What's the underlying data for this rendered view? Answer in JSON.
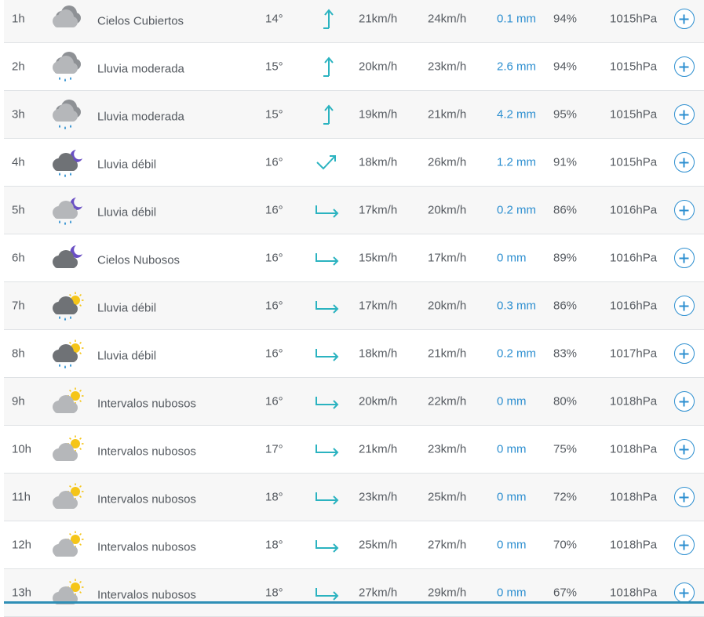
{
  "colors": {
    "rain_text": "#2d8fd0",
    "wind_arrow": "#2bb3c0",
    "plus_button": "#2d8fd0",
    "cloud_light": "#b5b7ba",
    "cloud_dark": "#6f7276",
    "sun": "#f5c518",
    "moon": "#6a4fc4",
    "raindrop": "#2d8fd0"
  },
  "rows": [
    {
      "hour": "1h",
      "icon": "overcast-cloud-icon",
      "description": "Cielos Cubiertos",
      "temperature": "14°",
      "wind_direction": "north-wind-icon",
      "wind": "21km/h",
      "gust": "24km/h",
      "rain": "0.1 mm",
      "humidity": "94%",
      "pressure": "1015hPa"
    },
    {
      "hour": "2h",
      "icon": "rain-cloud-icon",
      "description": "Lluvia moderada",
      "temperature": "15°",
      "wind_direction": "north-wind-icon",
      "wind": "20km/h",
      "gust": "23km/h",
      "rain": "2.6 mm",
      "humidity": "94%",
      "pressure": "1015hPa"
    },
    {
      "hour": "3h",
      "icon": "rain-cloud-icon",
      "description": "Lluvia moderada",
      "temperature": "15°",
      "wind_direction": "north-wind-icon",
      "wind": "19km/h",
      "gust": "21km/h",
      "rain": "4.2 mm",
      "humidity": "95%",
      "pressure": "1015hPa"
    },
    {
      "hour": "4h",
      "icon": "night-rain-dark-cloud-icon",
      "description": "Lluvia débil",
      "temperature": "16°",
      "wind_direction": "northeast-wind-icon",
      "wind": "18km/h",
      "gust": "26km/h",
      "rain": "1.2 mm",
      "humidity": "91%",
      "pressure": "1015hPa"
    },
    {
      "hour": "5h",
      "icon": "night-rain-cloud-icon",
      "description": "Lluvia débil",
      "temperature": "16°",
      "wind_direction": "east-wind-icon",
      "wind": "17km/h",
      "gust": "20km/h",
      "rain": "0.2 mm",
      "humidity": "86%",
      "pressure": "1016hPa"
    },
    {
      "hour": "6h",
      "icon": "night-dark-cloud-icon",
      "description": "Cielos Nubosos",
      "temperature": "16°",
      "wind_direction": "east-wind-icon",
      "wind": "15km/h",
      "gust": "17km/h",
      "rain": "0 mm",
      "humidity": "89%",
      "pressure": "1016hPa"
    },
    {
      "hour": "7h",
      "icon": "sun-rain-dark-cloud-icon",
      "description": "Lluvia débil",
      "temperature": "16°",
      "wind_direction": "east-wind-icon",
      "wind": "17km/h",
      "gust": "20km/h",
      "rain": "0.3 mm",
      "humidity": "86%",
      "pressure": "1016hPa"
    },
    {
      "hour": "8h",
      "icon": "sun-rain-dark-cloud-icon",
      "description": "Lluvia débil",
      "temperature": "16°",
      "wind_direction": "east-wind-icon",
      "wind": "18km/h",
      "gust": "21km/h",
      "rain": "0.2 mm",
      "humidity": "83%",
      "pressure": "1017hPa"
    },
    {
      "hour": "9h",
      "icon": "partly-cloudy-icon",
      "description": "Intervalos nubosos",
      "temperature": "16°",
      "wind_direction": "east-wind-icon",
      "wind": "20km/h",
      "gust": "22km/h",
      "rain": "0 mm",
      "humidity": "80%",
      "pressure": "1018hPa"
    },
    {
      "hour": "10h",
      "icon": "partly-cloudy-icon",
      "description": "Intervalos nubosos",
      "temperature": "17°",
      "wind_direction": "east-wind-icon",
      "wind": "21km/h",
      "gust": "23km/h",
      "rain": "0 mm",
      "humidity": "75%",
      "pressure": "1018hPa"
    },
    {
      "hour": "11h",
      "icon": "partly-cloudy-icon",
      "description": "Intervalos nubosos",
      "temperature": "18°",
      "wind_direction": "east-wind-icon",
      "wind": "23km/h",
      "gust": "25km/h",
      "rain": "0 mm",
      "humidity": "72%",
      "pressure": "1018hPa"
    },
    {
      "hour": "12h",
      "icon": "partly-cloudy-icon",
      "description": "Intervalos nubosos",
      "temperature": "18°",
      "wind_direction": "east-wind-icon",
      "wind": "25km/h",
      "gust": "27km/h",
      "rain": "0 mm",
      "humidity": "70%",
      "pressure": "1018hPa"
    },
    {
      "hour": "13h",
      "icon": "partly-cloudy-icon",
      "description": "Intervalos nubosos",
      "temperature": "18°",
      "wind_direction": "east-wind-icon",
      "wind": "27km/h",
      "gust": "29km/h",
      "rain": "0 mm",
      "humidity": "67%",
      "pressure": "1018hPa"
    }
  ],
  "more_button_icon": "plus-icon"
}
